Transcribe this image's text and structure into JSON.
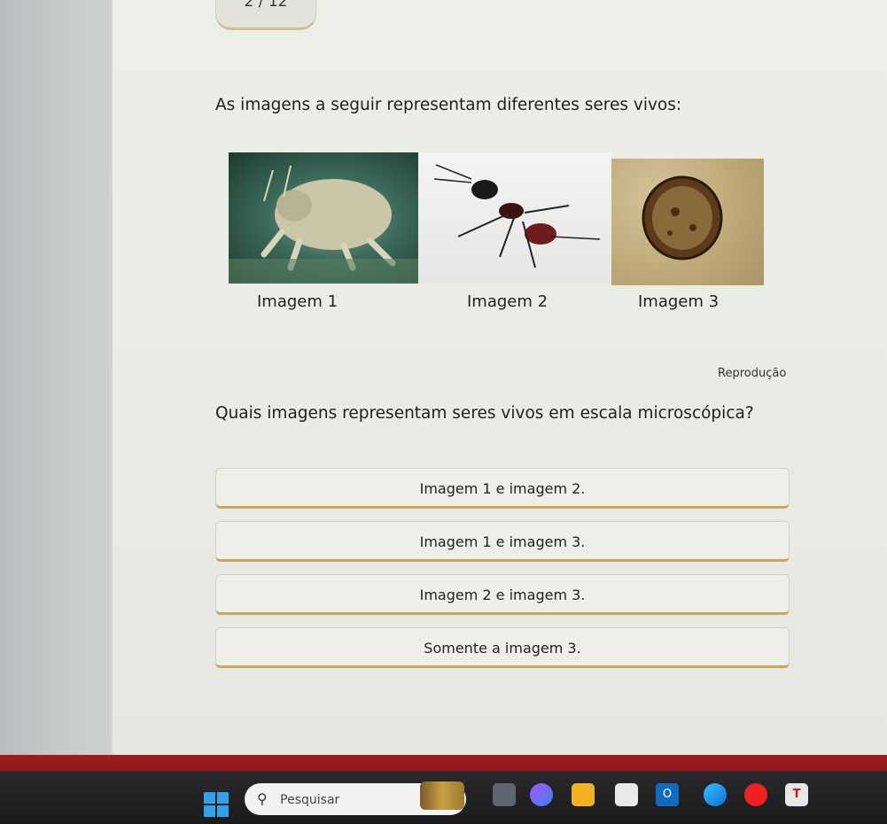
{
  "header": {
    "counter": "2 / 12"
  },
  "question": {
    "intro": "As imagens a seguir representam diferentes seres vivos:",
    "prompt": "Quais imagens representam seres vivos em escala microscópica?"
  },
  "figures": {
    "captions": [
      "Imagem 1",
      "Imagem 2",
      "Imagem 3"
    ],
    "credit": "Reprodução"
  },
  "options": [
    {
      "label": "Imagem 1 e imagem 2."
    },
    {
      "label": "Imagem 1 e imagem 3."
    },
    {
      "label": "Imagem 2 e imagem 3."
    },
    {
      "label": "Somente a imagem 3."
    }
  ],
  "taskbar": {
    "search_placeholder": "Pesquisar",
    "icons": [
      "start-icon",
      "search-icon",
      "app-icon",
      "copilot-icon",
      "file-explorer-icon",
      "calculator-icon",
      "outlook-icon",
      "edge-icon",
      "opera-icon",
      "teams-icon"
    ],
    "outlook_letter": "O",
    "teams_letter": "T"
  }
}
